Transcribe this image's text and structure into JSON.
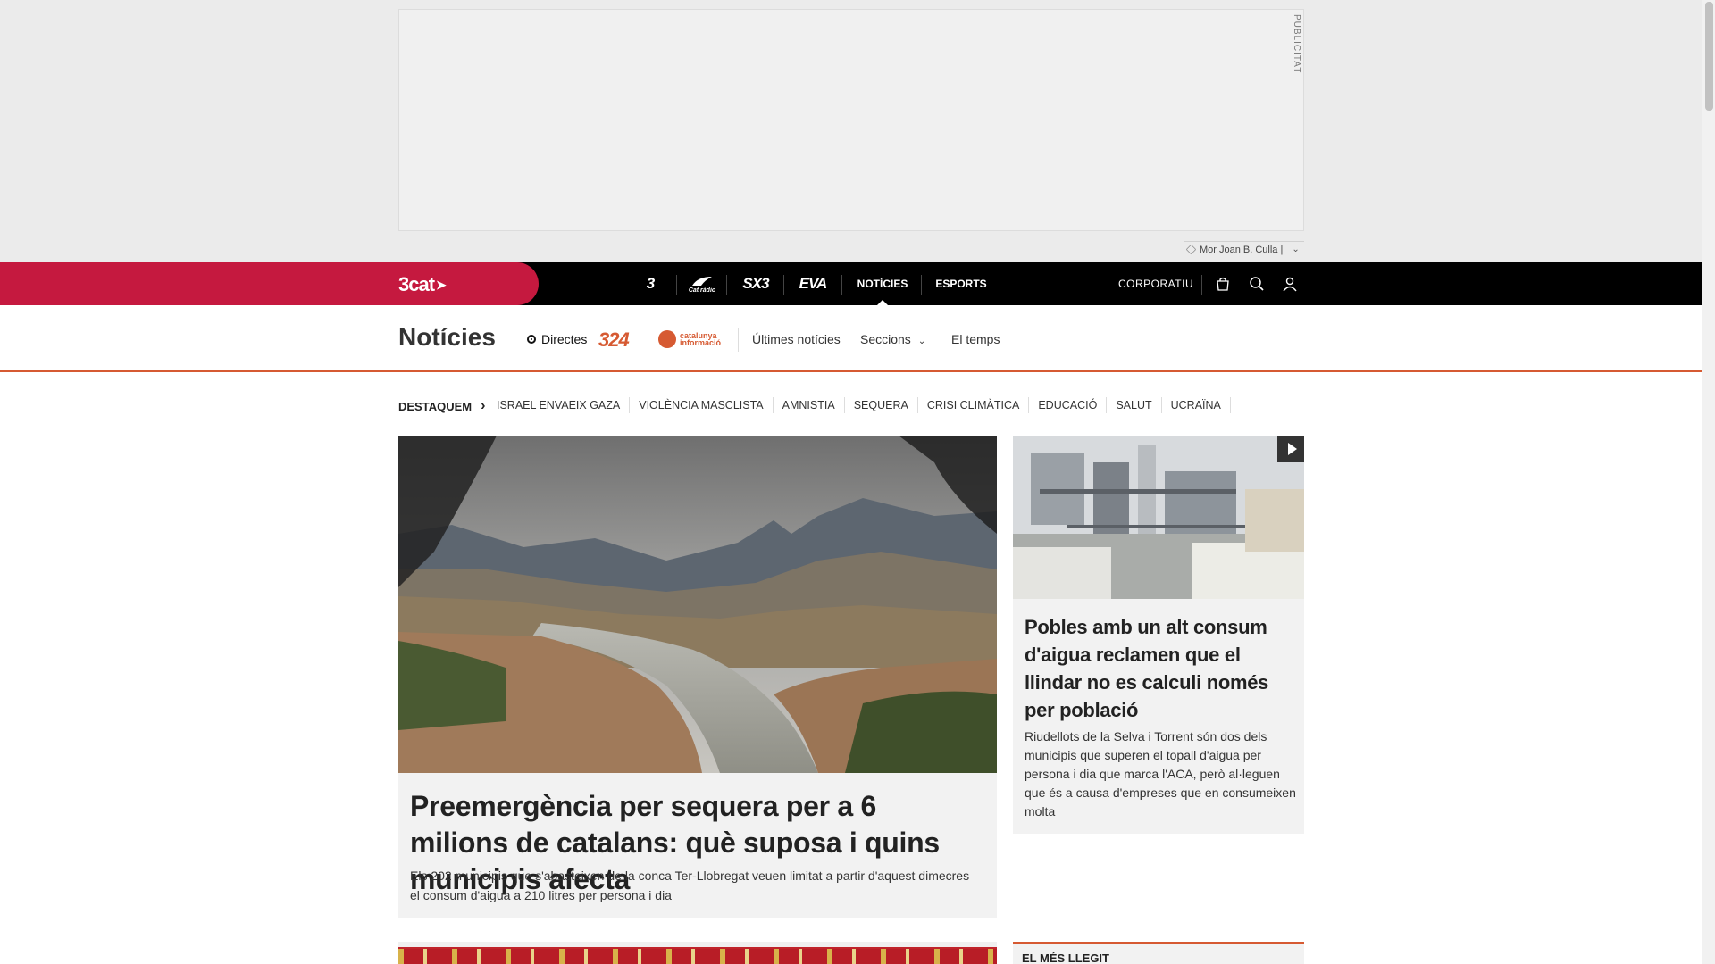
{
  "ad": {
    "label": "PUBLICITAT",
    "ticker": "Mor Joan B. Culla |"
  },
  "topbar": {
    "brand": "3cat",
    "channels": [
      {
        "label": "3",
        "type": "logo"
      },
      {
        "label": "Cat ràdio",
        "type": "logo"
      },
      {
        "label": "SX3",
        "type": "logo"
      },
      {
        "label": "EVA",
        "type": "logo"
      },
      {
        "label": "NOTÍCIES",
        "type": "text",
        "active": true
      },
      {
        "label": "ESPORTS",
        "type": "text"
      }
    ],
    "corporate": "CORPORATIU",
    "icons": [
      "shop-bag-icon",
      "search-icon",
      "user-icon"
    ]
  },
  "section": {
    "title": "Notícies",
    "live": "Directes",
    "channel_324": "324",
    "channel_ci": "catalunya informació",
    "nav": [
      "Últimes notícies",
      "Seccions",
      "El temps"
    ]
  },
  "highlights": {
    "label": "DESTAQUEM",
    "tags": [
      "ISRAEL ENVAEIX GAZA",
      "VIOLÈNCIA MASCLISTA",
      "AMNISTIA",
      "SEQUERA",
      "CRISI CLIMÀTICA",
      "EDUCACIÓ",
      "SALUT",
      "UCRAÏNA"
    ]
  },
  "main_article": {
    "title": "Preemergència per sequera per a 6 milions de catalans: què suposa i quins municipis afecta",
    "summary": "Els 202 municipis que s'abasteixen de la conca Ter-Llobregat veuen limitat a partir d'aquest dimecres el consum d'aigua a 210 litres per persona i dia"
  },
  "side_article": {
    "title": "Pobles amb un alt consum d'aigua reclamen que el llindar no es calculi només per població",
    "summary": "Riudellots de la Selva i Torrent són dos dels municipis que superen el topall d'aigua per persona i dia que marca l'ACA, però al·leguen que és a causa d'empreses que en consumeixen molta"
  },
  "most_read": {
    "label": "EL MÉS LLEGIT"
  },
  "colors": {
    "brand": "#c5193f",
    "accent": "#d65a32",
    "topbar": "#000000"
  }
}
